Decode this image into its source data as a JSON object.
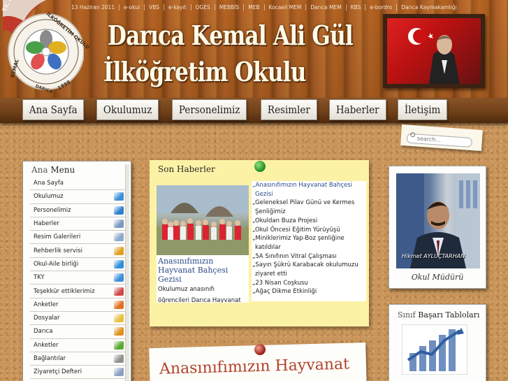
{
  "topbar": {
    "date": "13 Haziran 2011",
    "links": [
      "e-okul",
      "VBS",
      "e-kayıt",
      "OGES",
      "MEBBİS",
      "MEB",
      "Kocaeli MEM",
      "Darıca MEM",
      "KBS",
      "e-bordro",
      "Darıca Kaymakamlığı"
    ]
  },
  "site": {
    "title_line1": "Darıca Kemal Ali Gül",
    "title_line2": "İlköğretim Okulu",
    "logo_text_top": "T.C. MİLLİ EĞİTİM",
    "logo_text_ring": "İLKÖĞRETİM OKULU",
    "logo_text_left": "KEMAL",
    "logo_text_bottom": "DARICA",
    "logo_year": "1998"
  },
  "nav": {
    "items": [
      "Ana Sayfa",
      "Okulumuz",
      "Personelimiz",
      "Resimler",
      "Haberler",
      "İletişim"
    ]
  },
  "search": {
    "placeholder": "search..."
  },
  "menu": {
    "title_a": "Ana ",
    "title_b": "Menu",
    "items": [
      {
        "label": "Ana Sayfa",
        "icon": "",
        "color": ""
      },
      {
        "label": "Okulumuz",
        "icon": "chart-icon",
        "color": "#3a8fd8"
      },
      {
        "label": "Personelimiz",
        "icon": "people-icon",
        "color": "#2f7fd0"
      },
      {
        "label": "Haberler",
        "icon": "newspaper-icon",
        "color": "#7a9ac0"
      },
      {
        "label": "Resim Galerileri",
        "icon": "gallery-icon",
        "color": "#8aa8c8"
      },
      {
        "label": "Rehberlik servisi",
        "icon": "puzzle-icon",
        "color": "#e0a020"
      },
      {
        "label": "Okul-Aile birliği",
        "icon": "family-icon",
        "color": "#2f8fd8"
      },
      {
        "label": "TKY",
        "icon": "chart-icon",
        "color": "#3a8fd8"
      },
      {
        "label": "Teşekkür ettiklerimiz",
        "icon": "award-icon",
        "color": "#d04848"
      },
      {
        "label": "Anketler",
        "icon": "puzzle-icon",
        "color": "#e07020"
      },
      {
        "label": "Dosyalar",
        "icon": "folder-icon",
        "color": "#e8c040"
      },
      {
        "label": "Darıca",
        "icon": "flask-icon",
        "color": "#e09020"
      },
      {
        "label": "Anketler",
        "icon": "bag-icon",
        "color": "#5aa830"
      },
      {
        "label": "Bağlantılar",
        "icon": "link-icon",
        "color": "#909090"
      },
      {
        "label": "Ziyaretçi Defteri",
        "icon": "guestbook-icon",
        "color": "#8aa0c0"
      }
    ]
  },
  "news": {
    "title": "Son Haberler",
    "feature_title": "Anasınıfımızın Hayvanat Bahçesi Gezisi",
    "feature_body": "Okulumuz anasınıfı öğrencileri Darıca Hayvanat Bahçesini gezdiler",
    "items": [
      "Anasınıfımızın Hayvanat Bahçesi Gezisi",
      "Geleneksel Pilav Günü ve Kermes Şenliğimiz",
      "Okuldan Buza Projesi",
      "Okul Öncesi Eğitim Yürüyüşü",
      "Miniklerimiz Yap-Boz şenliğine katıldılar",
      "5A Sınıfının Vitral Çalışması",
      "Sayın Şükrü Karabacak okulumuzu ziyaret etti",
      "23 Nisan Coşkusu",
      "Ağaç Dikme Etkinliği"
    ]
  },
  "principal": {
    "name": "Hikmet AYLUÇTARHAN",
    "role": "Okul Müdürü"
  },
  "tables_card": {
    "title_a": "Sınıf ",
    "title_b": "Başarı Tabloları"
  },
  "article": {
    "title": "Anasınıfımızın Hayvanat"
  },
  "colors": {
    "nav_shelf": "#6e3f18",
    "news_note": "#fcf2a6",
    "article_title": "#b2412a",
    "link_blue": "#2c4a8a",
    "cork": "#c9955a"
  }
}
